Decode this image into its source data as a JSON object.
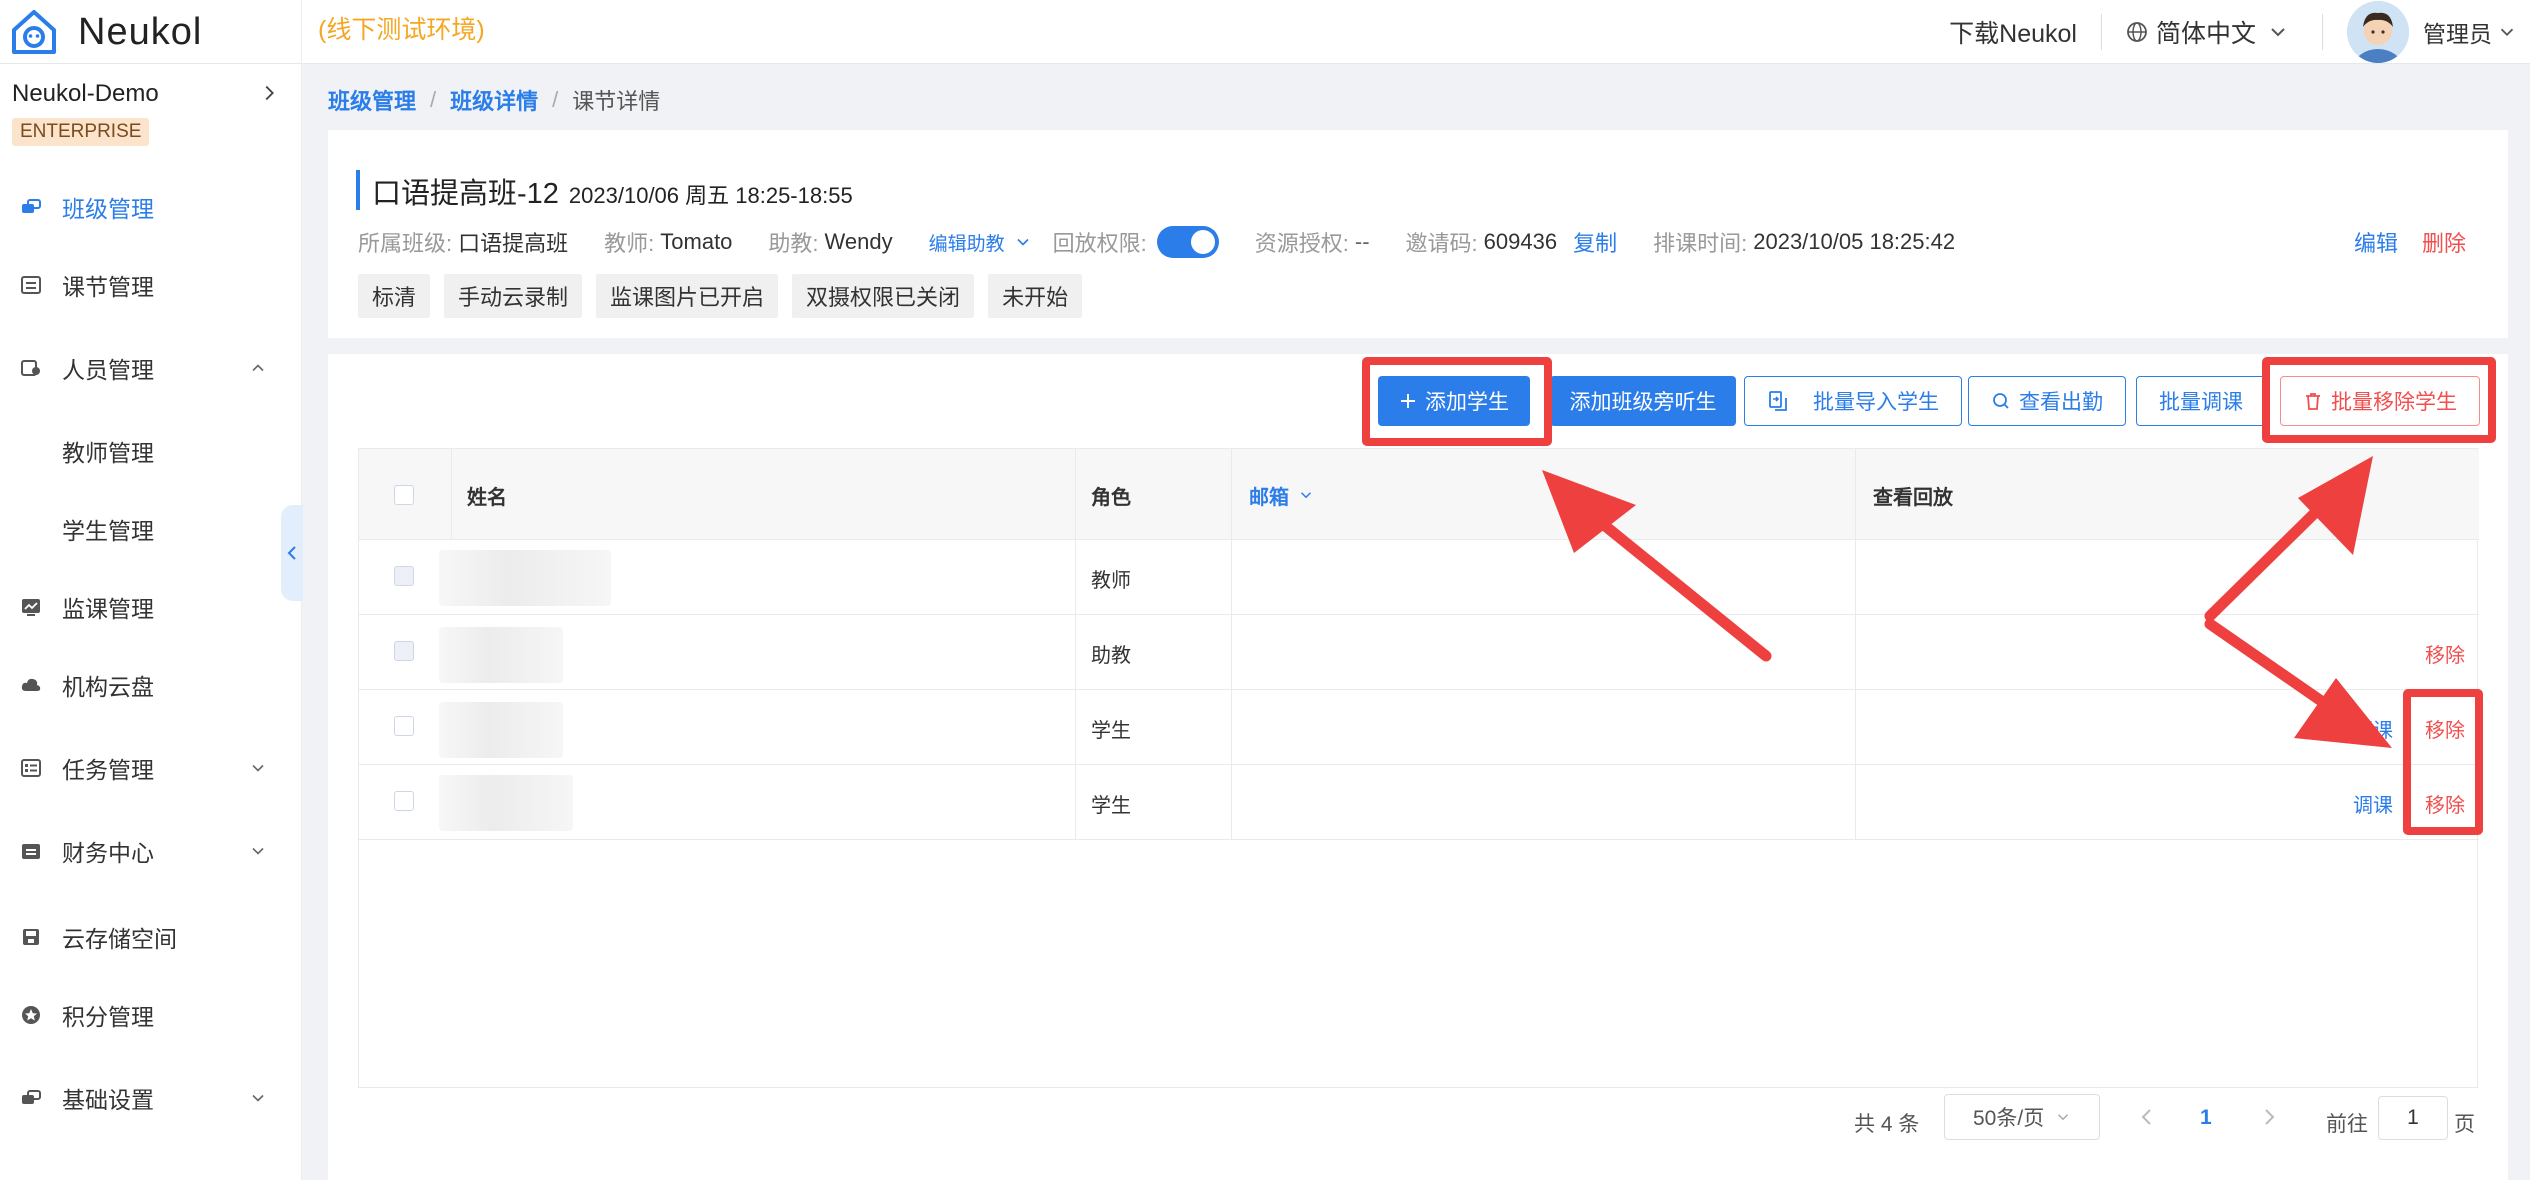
{
  "header": {
    "logo_text": "Neukol",
    "env_label": "(线下测试环境)",
    "download_label": "下载Neukol",
    "language_label": "简体中文",
    "user_label": "管理员"
  },
  "sidebar": {
    "org_name": "Neukol-Demo",
    "edition": "ENTERPRISE",
    "items": [
      {
        "label": "班级管理"
      },
      {
        "label": "课节管理"
      },
      {
        "label": "人员管理"
      },
      {
        "label": "教师管理"
      },
      {
        "label": "学生管理"
      },
      {
        "label": "监课管理"
      },
      {
        "label": "机构云盘"
      },
      {
        "label": "任务管理"
      },
      {
        "label": "财务中心"
      },
      {
        "label": "云存储空间"
      },
      {
        "label": "积分管理"
      },
      {
        "label": "基础设置"
      }
    ]
  },
  "breadcrumb": {
    "items": [
      "班级管理",
      "班级详情",
      "课节详情"
    ],
    "separator": "/"
  },
  "lesson": {
    "title": "口语提高班-12",
    "time": "2023/10/06 周五 18:25-18:55",
    "class_label": "所属班级:",
    "class_value": "口语提高班",
    "teacher_label": "教师:",
    "teacher_value": "Tomato",
    "assistant_label": "助教:",
    "assistant_value": "Wendy",
    "edit_assistant": "编辑助教",
    "playback_label": "回放权限:",
    "playback_enabled": true,
    "resource_label": "资源授权:",
    "resource_value": "--",
    "invite_label": "邀请码:",
    "invite_value": "609436",
    "copy_label": "复制",
    "schedule_label": "排课时间:",
    "schedule_value": "2023/10/05 18:25:42",
    "edit_label": "编辑",
    "delete_label": "删除",
    "tags": [
      "标清",
      "手动云录制",
      "监课图片已开启",
      "双摄权限已关闭",
      "未开始"
    ]
  },
  "toolbar": {
    "add_student": "添加学生",
    "add_auditor": "添加班级旁听生",
    "batch_import": "批量导入学生",
    "view_attendance": "查看出勤",
    "batch_transfer": "批量调课",
    "batch_remove": "批量移除学生"
  },
  "table": {
    "columns": {
      "name": "姓名",
      "role": "角色",
      "email": "邮箱",
      "playback": "查看回放"
    },
    "rows": [
      {
        "role": "教师",
        "actions": []
      },
      {
        "role": "助教",
        "actions": [
          "移除"
        ]
      },
      {
        "role": "学生",
        "actions": [
          "调课",
          "移除"
        ]
      },
      {
        "role": "学生",
        "actions": [
          "调课",
          "移除"
        ]
      }
    ],
    "transfer_label": "调课",
    "remove_label": "移除"
  },
  "pagination": {
    "total": "共 4 条",
    "page_size": "50条/页",
    "current_page": "1",
    "goto_label": "前往",
    "goto_value": "1",
    "page_suffix": "页"
  },
  "colors": {
    "accent": "#2b7de9",
    "danger": "#f24e4e",
    "env": "#f5a623",
    "annotation": "#ef4040"
  }
}
